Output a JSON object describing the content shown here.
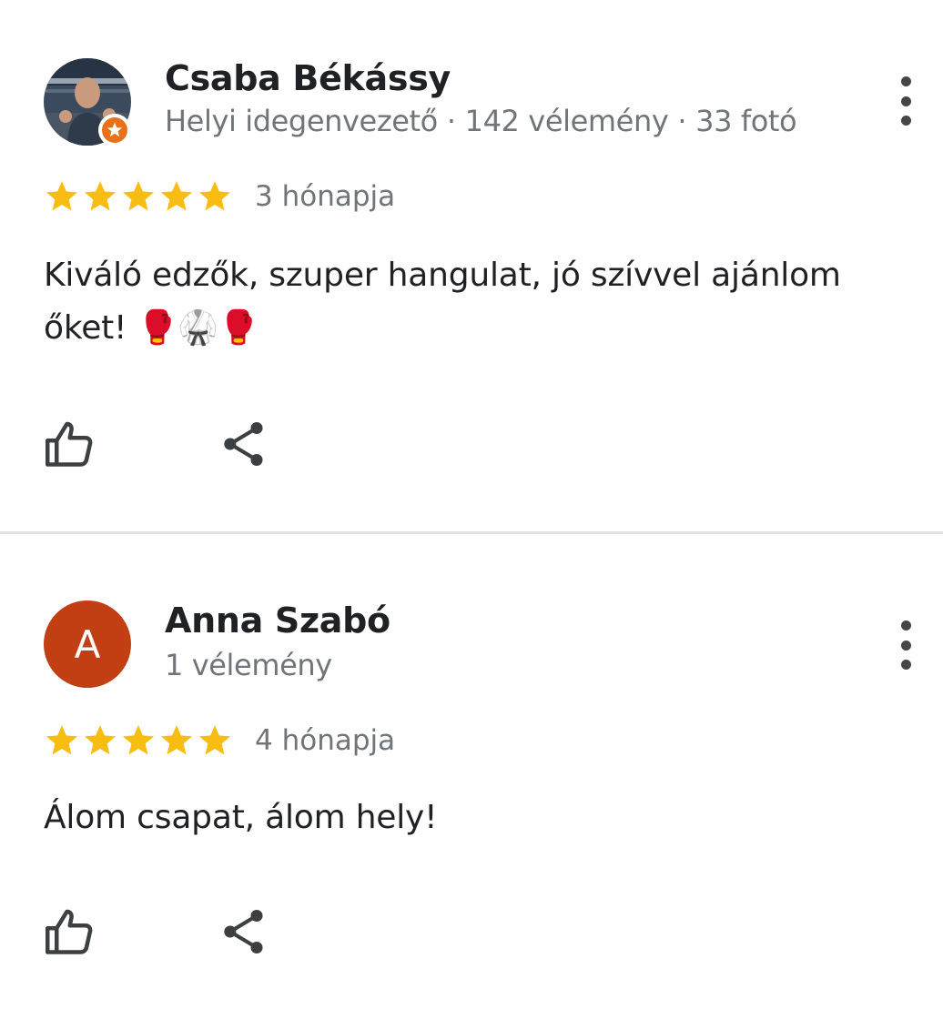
{
  "reviews": [
    {
      "author": "Csaba Békássy",
      "badge": "Helyi idegenvezető",
      "review_count": "142 vélemény",
      "photo_count": "33 fotó",
      "separator": "·",
      "stars": 5,
      "date": "3 hónapja",
      "text": "Kiváló edzők, szuper hangulat, jó szívvel ajánlom őket! 🥊🥋🥊",
      "avatar": "photo",
      "badge_icon": "local-guide-star-icon"
    },
    {
      "author": "Anna Szabó",
      "avatar_letter": "A",
      "avatar_color": "#c23e13",
      "review_count": "1 vélemény",
      "stars": 5,
      "date": "4 hónapja",
      "text": "Álom csapat, álom hely!"
    }
  ],
  "colors": {
    "star": "#f7bd13",
    "guide_badge": "#e8711a",
    "secondary_text": "#70757a",
    "icon": "#3c4043"
  },
  "icons": {
    "like": "thumbs-up-icon",
    "share": "share-icon",
    "more": "more-vert-icon"
  }
}
